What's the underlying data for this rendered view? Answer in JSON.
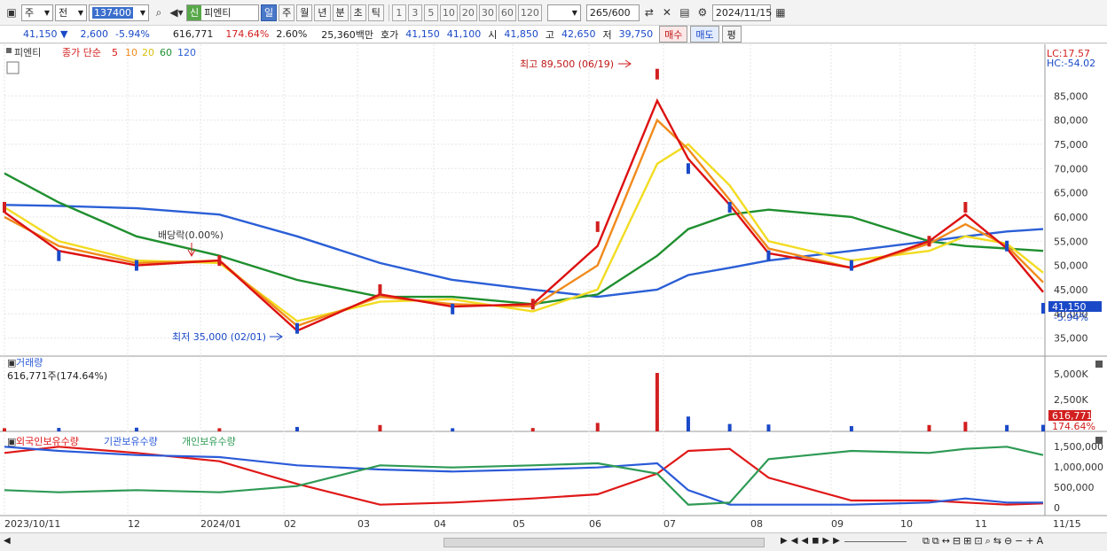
{
  "toolbar": {
    "market": "주",
    "type": "전",
    "code": "137400",
    "name_badge": "신",
    "name": "피엔티",
    "periods": [
      "일",
      "주",
      "월",
      "년",
      "분",
      "초",
      "틱"
    ],
    "selected_period": "일",
    "intervals": [
      "1",
      "3",
      "5",
      "10",
      "20",
      "30",
      "60",
      "120"
    ],
    "count": "265",
    "count_total": "/600",
    "date": "2024/11/15"
  },
  "quote": {
    "price": "41,150",
    "arrow": "▼",
    "change": "2,600",
    "change_pct": "-5.94%",
    "volume": "616,771",
    "volume_pct": "174.64%",
    "turnover": "2.60%",
    "amount": "25,360백만",
    "bid_label": "호가",
    "ask": "41,150",
    "bid": "41,100",
    "open_label": "시",
    "open": "41,850",
    "high_label": "고",
    "high": "42,650",
    "low_label": "저",
    "low": "39,750",
    "buy": "매수",
    "sell": "매도",
    "eval": "평"
  },
  "price_panel": {
    "title": "피엔티",
    "legend_prefix": "종가 단순",
    "ma_labels": [
      "5",
      "10",
      "20",
      "60",
      "120"
    ],
    "lc": "LC:17.57",
    "hc": "HC:-54.02",
    "high_note": "최고 89,500 (06/19)",
    "low_note": "최저 35,000 (02/01)",
    "dividend_note": "배당락(0.00%)",
    "last_price": "41,150",
    "last_pct": "-5.94%"
  },
  "volume_panel": {
    "title": "거래량",
    "value": "616,771주(174.64%)",
    "last": "616,771",
    "last_pct": "174.64%",
    "ticks": [
      "5,000K",
      "2,500K"
    ]
  },
  "holding_panel": {
    "labels": [
      "외국인보유수량",
      "기관보유수량",
      "개인보유수량"
    ],
    "ticks": [
      "1,500,000",
      "1,000,000",
      "500,000",
      "0"
    ]
  },
  "x_axis": [
    "2023/10/11",
    "12",
    "2024/01",
    "02",
    "03",
    "04",
    "05",
    "06",
    "07",
    "08",
    "09",
    "10",
    "11",
    "11/15"
  ],
  "colors": {
    "up": "#d21f1f",
    "down": "#1a49c8",
    "ma5": "#dd1111",
    "ma10": "#f08a1c",
    "ma20": "#f2dc22",
    "ma60": "#1f8f2f",
    "ma120": "#2b5fd6",
    "foreign": "#e01818",
    "inst": "#2a5ad8",
    "indiv": "#2e9a55"
  },
  "chart_data": {
    "type": "line",
    "ylim": [
      32000,
      92000
    ],
    "x": [
      "2023-10-11",
      "2023-11-01",
      "2023-12-01",
      "2024-01-02",
      "2024-02-01",
      "2024-03-04",
      "2024-04-01",
      "2024-05-02",
      "2024-05-27",
      "2024-06-19",
      "2024-07-01",
      "2024-07-17",
      "2024-08-01",
      "2024-09-02",
      "2024-10-02",
      "2024-10-16",
      "2024-11-01",
      "2024-11-15"
    ],
    "series": [
      {
        "values": [
          62000,
          52000,
          50000,
          51000,
          37000,
          45000,
          41000,
          42000,
          58000,
          89500,
          70000,
          62000,
          52000,
          50000,
          55000,
          62000,
          54000,
          41150
        ]
      },
      {
        "name": "5",
        "values": [
          61000,
          53000,
          50000,
          51000,
          36500,
          44000,
          41500,
          42000,
          54000,
          84000,
          72000,
          62500,
          52500,
          49500,
          55000,
          60500,
          53500,
          44500
        ]
      },
      {
        "name": "10",
        "values": [
          60000,
          54000,
          50500,
          51000,
          37500,
          43500,
          42000,
          41500,
          50000,
          80000,
          74000,
          63500,
          53500,
          49500,
          54500,
          58500,
          54000,
          46500
        ]
      },
      {
        "name": "20",
        "values": [
          62000,
          55000,
          51000,
          50500,
          38500,
          42500,
          43000,
          40500,
          45000,
          71000,
          75000,
          66500,
          55000,
          51000,
          53000,
          56000,
          54500,
          48500
        ]
      },
      {
        "name": "60",
        "values": [
          69000,
          63000,
          56000,
          52000,
          47000,
          43500,
          43500,
          42000,
          44000,
          52000,
          57500,
          60500,
          61500,
          60000,
          55000,
          54000,
          53500,
          53000
        ]
      },
      {
        "name": "120",
        "values": [
          62500,
          62300,
          61800,
          60500,
          56000,
          50500,
          47000,
          45000,
          43500,
          45000,
          48000,
          49500,
          51000,
          53000,
          55000,
          56000,
          57000,
          57500
        ]
      }
    ],
    "volume_k": [
      300,
      330,
      350,
      300,
      420,
      600,
      300,
      320,
      800,
      5500,
      1400,
      700,
      650,
      500,
      600,
      900,
      600,
      617
    ],
    "holdings": {
      "foreign": [
        1300000,
        1450000,
        1300000,
        1100000,
        550000,
        50000,
        100000,
        200000,
        300000,
        800000,
        1350000,
        1400000,
        700000,
        150000,
        150000,
        100000,
        50000,
        80000
      ],
      "inst": [
        1450000,
        1350000,
        1250000,
        1200000,
        1000000,
        900000,
        850000,
        900000,
        950000,
        1050000,
        400000,
        50000,
        50000,
        50000,
        100000,
        200000,
        100000,
        100000
      ],
      "indiv": [
        400000,
        350000,
        400000,
        350000,
        500000,
        1000000,
        950000,
        1000000,
        1050000,
        800000,
        50000,
        100000,
        1150000,
        1350000,
        1300000,
        1400000,
        1450000,
        1250000
      ]
    }
  }
}
